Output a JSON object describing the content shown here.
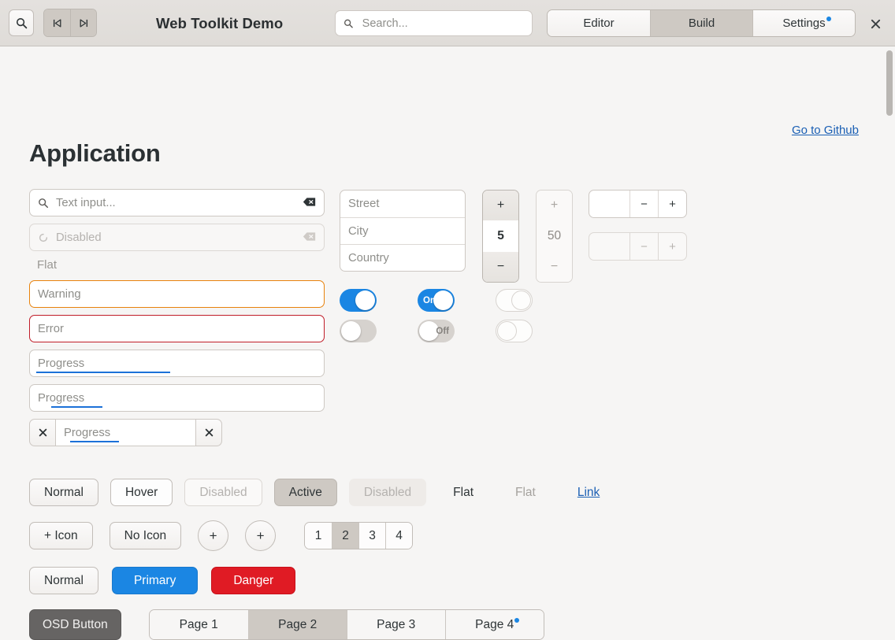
{
  "header": {
    "title": "Web Toolkit Demo",
    "search_icon": "search-icon",
    "search_placeholder": "Search...",
    "nav_first_icon": "skip-to-start-icon",
    "nav_last_icon": "skip-to-end-icon",
    "close_icon": "close-icon",
    "tabs": [
      {
        "label": "Editor",
        "active": false,
        "badge": false
      },
      {
        "label": "Build",
        "active": true,
        "badge": false
      },
      {
        "label": "Settings",
        "active": false,
        "badge": true
      }
    ]
  },
  "main": {
    "page_title": "Application",
    "github_link": "Go to Github"
  },
  "inputs": {
    "text_input": {
      "placeholder": "Text input...",
      "icon": "search-icon",
      "clear_icon": "backspace-icon"
    },
    "disabled_input": {
      "placeholder": "Disabled",
      "icon": "spinner-icon",
      "clear_icon": "backspace-icon"
    },
    "flat_label": "Flat",
    "warning": {
      "placeholder": "Warning"
    },
    "error": {
      "placeholder": "Error"
    },
    "progress_1": {
      "placeholder": "Progress",
      "progress": 45
    },
    "progress_2": {
      "placeholder": "Progress",
      "progress": 25
    },
    "progress_group": {
      "left_button_icon": "close-icon",
      "placeholder": "Progress",
      "progress": 30,
      "right_button_icon": "close-icon"
    }
  },
  "address": {
    "street": "Street",
    "city": "City",
    "country": "Country"
  },
  "spinners": {
    "vertical": [
      {
        "value": "5",
        "plus": "+",
        "minus": "−",
        "enabled": true
      },
      {
        "value": "50",
        "plus": "+",
        "minus": "−",
        "enabled": false
      }
    ],
    "horizontal": [
      {
        "value": "",
        "minus": "−",
        "plus": "+",
        "enabled": true
      },
      {
        "value": "",
        "minus": "−",
        "plus": "+",
        "enabled": false
      }
    ]
  },
  "toggles": [
    {
      "state": "on",
      "label": ""
    },
    {
      "state": "on",
      "label": "On"
    },
    {
      "state": "empty-right",
      "label": ""
    },
    {
      "state": "off",
      "label": ""
    },
    {
      "state": "off",
      "label": "Off"
    },
    {
      "state": "empty-left",
      "label": ""
    }
  ],
  "buttons": {
    "row1": [
      {
        "label": "Normal",
        "style": "normal"
      },
      {
        "label": "Hover",
        "style": "hover"
      },
      {
        "label": "Disabled",
        "style": "disabled"
      },
      {
        "label": "Active",
        "style": "active"
      },
      {
        "label": "Disabled",
        "style": "flatdis"
      },
      {
        "label": "Flat",
        "style": "flat"
      },
      {
        "label": "Flat",
        "style": "flat-dim"
      },
      {
        "label": "Link",
        "style": "link"
      }
    ],
    "row2": [
      {
        "label": "+ Icon",
        "style": "normal"
      },
      {
        "label": "No Icon",
        "style": "normal"
      },
      {
        "label": "+",
        "style": "circle"
      },
      {
        "label": "+",
        "style": "circle"
      }
    ],
    "pager": [
      {
        "label": "1",
        "selected": false
      },
      {
        "label": "2",
        "selected": true
      },
      {
        "label": "3",
        "selected": false
      },
      {
        "label": "4",
        "selected": false
      }
    ],
    "row3": [
      {
        "label": "Normal",
        "style": "normal"
      },
      {
        "label": "Primary",
        "style": "primary"
      },
      {
        "label": "Danger",
        "style": "danger"
      }
    ],
    "osd": {
      "label": "OSD Button"
    },
    "page_tabs": [
      {
        "label": "Page 1",
        "selected": false,
        "badge": false
      },
      {
        "label": "Page 2",
        "selected": true,
        "badge": false
      },
      {
        "label": "Page 3",
        "selected": false,
        "badge": false
      },
      {
        "label": "Page 4",
        "selected": false,
        "badge": true
      }
    ]
  },
  "colors": {
    "primary": "#1b86e3",
    "danger": "#e01b24",
    "warning": "#e8820c",
    "error": "#c01c28",
    "link": "#1a5fb4",
    "badge": "#1b86e3"
  }
}
